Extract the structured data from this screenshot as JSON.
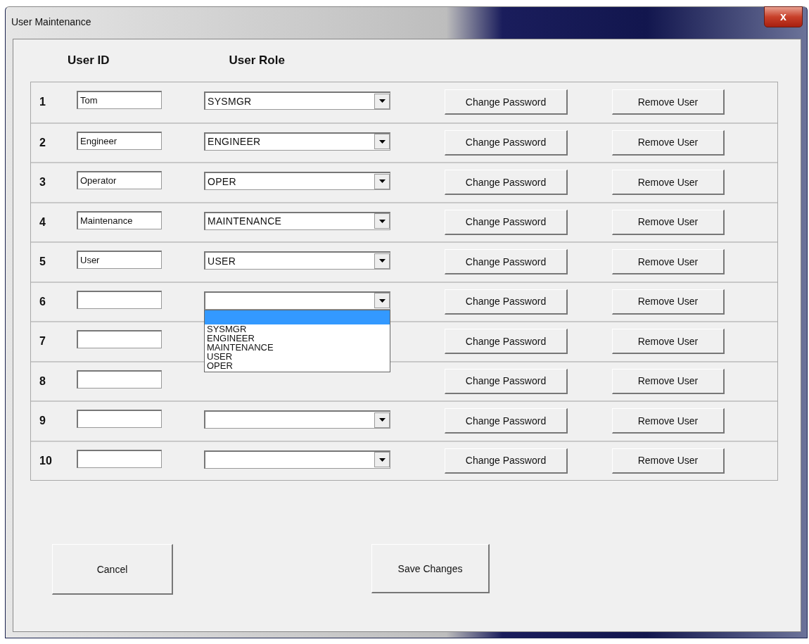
{
  "window": {
    "title": "User Maintenance",
    "close": "x"
  },
  "headers": {
    "user_id": "User ID",
    "user_role": "User Role"
  },
  "rows": [
    {
      "number": "1",
      "user_id": "Tom",
      "role_visible": true,
      "role": "SYSMGR",
      "change_password": "Change Password",
      "remove": "Remove User"
    },
    {
      "number": "2",
      "user_id": "Engineer",
      "role_visible": true,
      "role": "ENGINEER",
      "change_password": "Change Password",
      "remove": "Remove User"
    },
    {
      "number": "3",
      "user_id": "Operator",
      "role_visible": true,
      "role": "OPER",
      "change_password": "Change Password",
      "remove": "Remove User"
    },
    {
      "number": "4",
      "user_id": "Maintenance",
      "role_visible": true,
      "role": "MAINTENANCE",
      "change_password": "Change Password",
      "remove": "Remove User"
    },
    {
      "number": "5",
      "user_id": "User",
      "role_visible": true,
      "role": "USER",
      "change_password": "Change Password",
      "remove": "Remove User"
    },
    {
      "number": "6",
      "role_visible": true,
      "change_password": "Change Password",
      "remove": "Remove User",
      "dropdown": {
        "options": [
          {
            "selected": true
          },
          {
            "label": "SYSMGR",
            "selected": false
          },
          {
            "label": "ENGINEER",
            "selected": false
          },
          {
            "label": "MAINTENANCE",
            "selected": false
          },
          {
            "label": "USER",
            "selected": false
          },
          {
            "label": "OPER",
            "selected": false
          }
        ]
      }
    },
    {
      "number": "7",
      "role_visible": false,
      "change_password": "Change Password",
      "remove": "Remove User"
    },
    {
      "number": "8",
      "role_visible": false,
      "change_password": "Change Password",
      "remove": "Remove User"
    },
    {
      "number": "9",
      "role_visible": true,
      "change_password": "Change Password",
      "remove": "Remove User"
    },
    {
      "number": "10",
      "role_visible": true,
      "change_password": "Change Password",
      "remove": "Remove User"
    }
  ],
  "buttons": [
    {
      "kind": "cancel",
      "label": "Cancel"
    },
    {
      "kind": "save",
      "label": "Save Changes"
    }
  ]
}
